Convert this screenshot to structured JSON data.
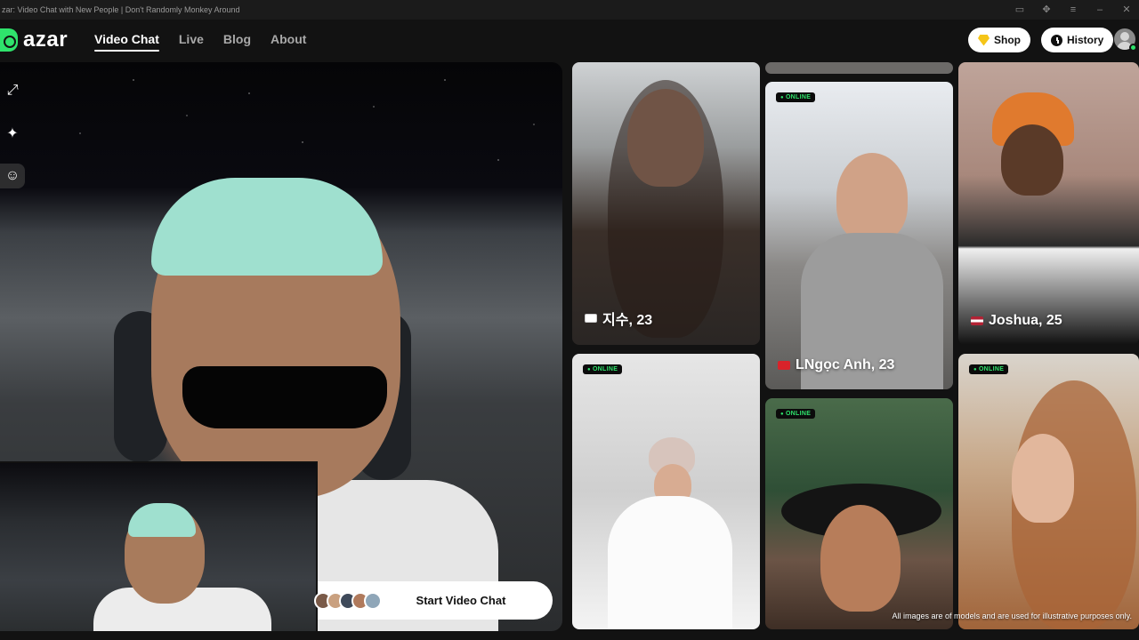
{
  "window": {
    "title": "zar: Video Chat with New People | Don't Randomly Monkey Around"
  },
  "header": {
    "logo_text": "azar",
    "nav": [
      {
        "label": "Video Chat",
        "active": true
      },
      {
        "label": "Live",
        "active": false
      },
      {
        "label": "Blog",
        "active": false
      },
      {
        "label": "About",
        "active": false
      }
    ],
    "shop_label": "Shop",
    "history_label": "History"
  },
  "main": {
    "start_label": "Start Video Chat"
  },
  "cards": [
    {
      "name": "지수, 23",
      "flag": "korea-flag",
      "online": false
    },
    {
      "name": "LNgọc Anh, 23",
      "flag": "vietnam-flag",
      "online": true
    },
    {
      "name": "Joshua, 25",
      "flag": "usa-flag",
      "online": false
    },
    {
      "name": "",
      "online": true
    },
    {
      "name": "",
      "online": true
    },
    {
      "name": "",
      "online": true
    }
  ],
  "online_label": "ONLINE",
  "disclaimer": "All images are of models and are used for illustrative purposes only.",
  "colors": {
    "brand_green": "#2fe36c",
    "shop_gem": "#f5c518",
    "background": "#121212"
  },
  "icons": [
    "camera-icon",
    "puzzle-icon",
    "menu-icon",
    "minimize-icon",
    "close-icon",
    "expand-icon",
    "sparkle-icon",
    "face-filter-icon",
    "diamond-icon",
    "clock-icon",
    "profile-icon"
  ]
}
